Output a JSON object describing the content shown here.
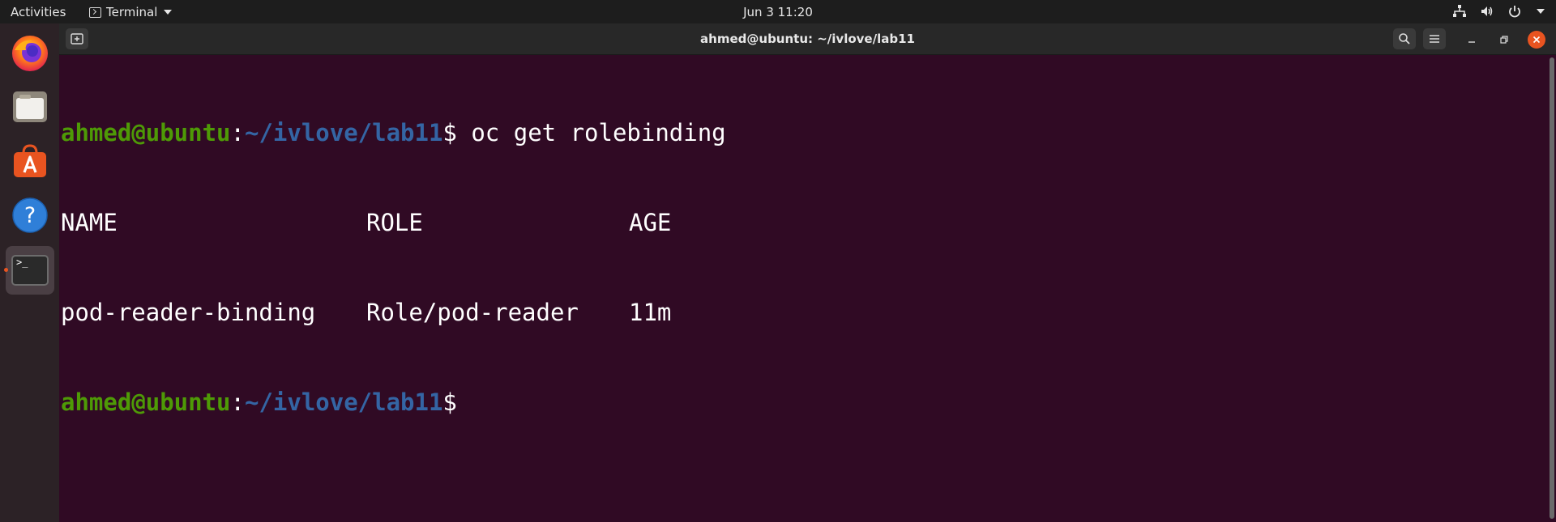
{
  "topbar": {
    "activities": "Activities",
    "app_name": "Terminal",
    "clock": "Jun 3  11:20"
  },
  "dock": {
    "items": [
      {
        "name": "firefox-icon"
      },
      {
        "name": "files-icon"
      },
      {
        "name": "software-icon"
      },
      {
        "name": "help-icon"
      },
      {
        "name": "terminal-icon",
        "active": true
      }
    ],
    "terminal_glyph": ">_"
  },
  "window": {
    "title": "ahmed@ubuntu: ~/ivlove/lab11"
  },
  "terminal": {
    "prompt_user": "ahmed@ubuntu",
    "prompt_sep": ":",
    "prompt_path": "~/ivlove/lab11",
    "prompt_symbol": "$",
    "command": " oc get rolebinding",
    "headers": [
      "NAME",
      "ROLE",
      "AGE"
    ],
    "rows": [
      [
        "pod-reader-binding",
        "Role/pod-reader",
        "11m"
      ]
    ]
  },
  "colors": {
    "terminal_bg": "#300a24",
    "prompt_user": "#4e9a06",
    "prompt_path": "#3465a4",
    "close_button": "#e95420"
  }
}
